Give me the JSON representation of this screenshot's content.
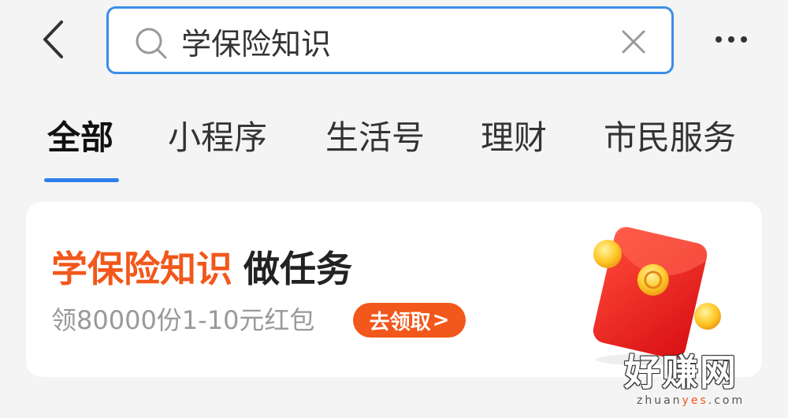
{
  "search": {
    "value": "学保险知识",
    "placeholder": ""
  },
  "tabs": [
    {
      "label": "全部",
      "active": true
    },
    {
      "label": "小程序",
      "active": false
    },
    {
      "label": "生活号",
      "active": false
    },
    {
      "label": "理财",
      "active": false
    },
    {
      "label": "市民服务",
      "active": false
    }
  ],
  "promo": {
    "title_highlight": "学保险知识",
    "title_rest": "做任务",
    "subtitle": "领80000份1-10元红包",
    "button_label": "去领取",
    "button_arrow": ">"
  },
  "watermark": {
    "logo": "好赚网",
    "url_prefix": "zhuan",
    "url_accent": "yes",
    "url_suffix": ".com"
  },
  "colors": {
    "accent_blue": "#2e7ee8",
    "search_border": "#3a8ee6",
    "promo_orange": "#f2571b",
    "page_bg": "#f4f4f4"
  },
  "icons": {
    "back": "back-arrow-icon",
    "search": "search-icon",
    "clear": "close-icon",
    "more": "more-dots-icon"
  }
}
